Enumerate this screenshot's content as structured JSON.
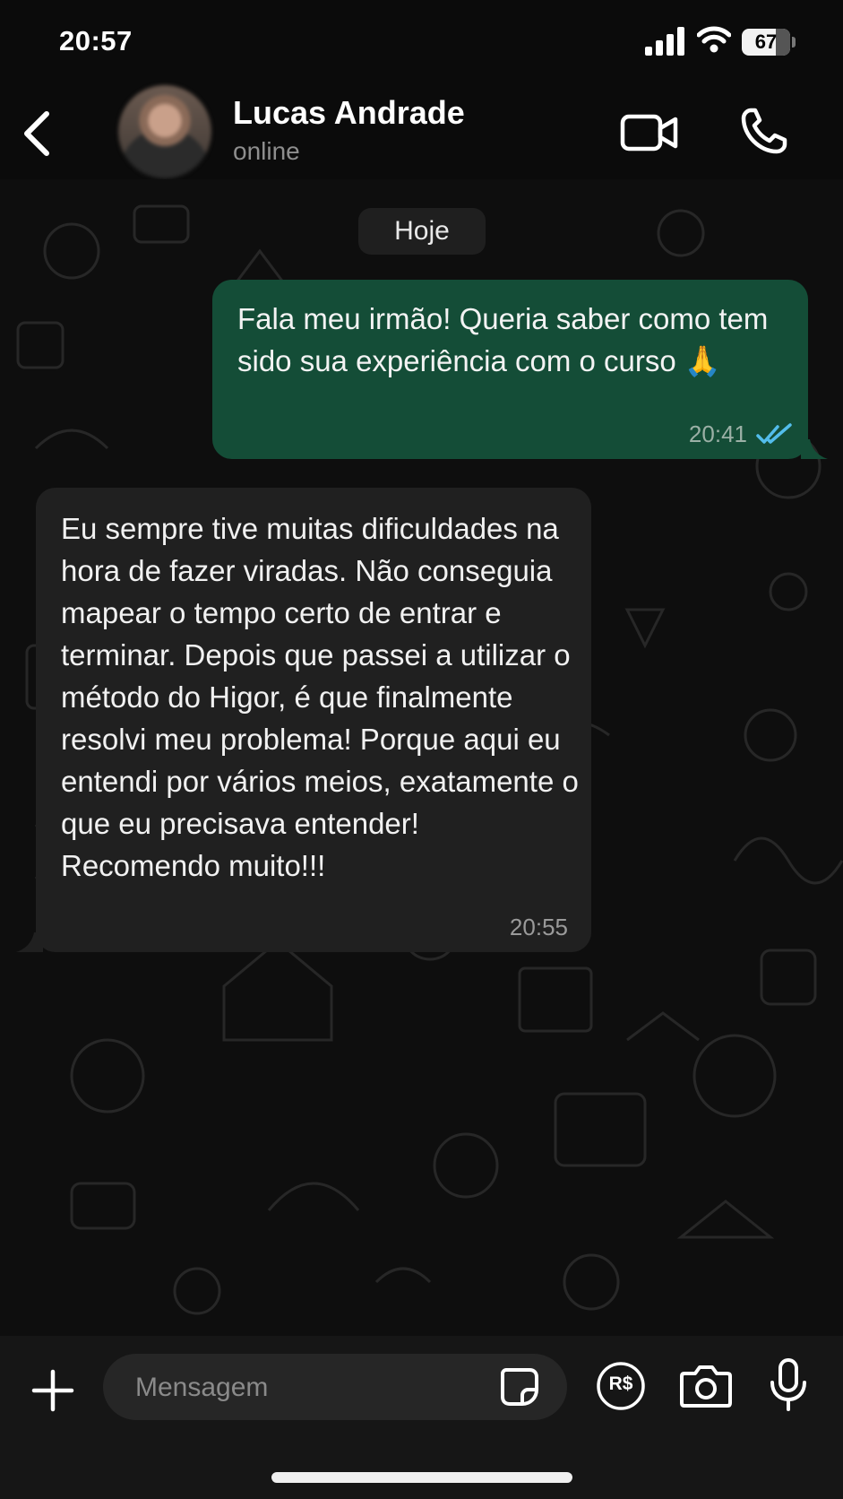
{
  "status_bar": {
    "time": "20:57",
    "battery": "67"
  },
  "header": {
    "contact_name": "Lucas Andrade",
    "contact_status": "online",
    "icons": [
      "back-chevron-icon",
      "avatar",
      "video-camera-icon",
      "phone-icon"
    ]
  },
  "chat": {
    "date_chip": "Hoje",
    "messages": [
      {
        "direction": "outgoing",
        "text": "Fala meu irmão! Queria saber como tem sido sua experiência com o curso 🙏",
        "time": "20:41",
        "status": "read"
      },
      {
        "direction": "incoming",
        "text": "Eu sempre tive muitas dificuldades na hora de fazer viradas. Não conseguia mapear o tempo certo de entrar e terminar. Depois que passei a utilizar o método do Higor, é que finalmente resolvi meu problema! Porque aqui eu entendi por vários meios, exatamente o que eu precisava entender! Recomendo muito!!!",
        "time": "20:55"
      }
    ]
  },
  "input_bar": {
    "placeholder": "Mensagem",
    "pay_label": "R$",
    "icons": [
      "plus-icon",
      "sticker-icon",
      "payment-icon",
      "camera-icon",
      "microphone-icon"
    ]
  },
  "colors": {
    "background": "#0b0b0b",
    "outgoing_bubble": "#144d37",
    "incoming_bubble": "#202020",
    "read_ticks": "#53bdeb"
  }
}
